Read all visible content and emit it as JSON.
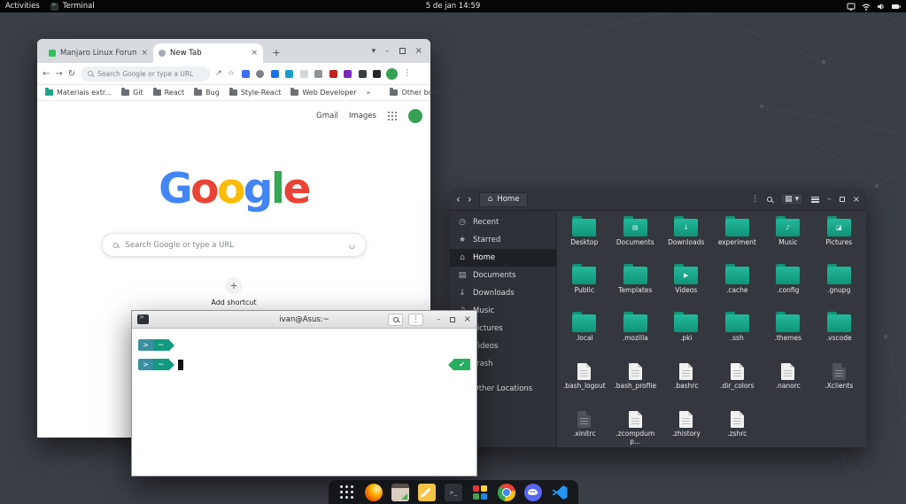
{
  "topbar": {
    "activities": "Activities",
    "focused_app": "Terminal",
    "clock": "5 de jan 14:59",
    "status_icons": [
      "display-icon",
      "wifi-icon",
      "volume-icon",
      "battery-icon"
    ]
  },
  "chrome_window": {
    "tabs": [
      {
        "title": "Manjaro Linux Forum"
      },
      {
        "title": "New Tab"
      }
    ],
    "omnibox": {
      "placeholder": "Search Google or type a URL"
    },
    "extensions": [
      {
        "name": "extension-icon-1",
        "color": "#3e6df0"
      },
      {
        "name": "extension-icon-2",
        "color": "#7b8187"
      },
      {
        "name": "extension-icon-3",
        "color": "#1a73e8"
      },
      {
        "name": "extension-icon-4",
        "color": "#15a0c8"
      },
      {
        "name": "extension-icon-5",
        "color": "#d3d6da"
      },
      {
        "name": "extension-icon-6",
        "color": "#8e9398"
      },
      {
        "name": "extension-icon-7",
        "color": "#c5221f"
      },
      {
        "name": "extension-icon-8",
        "color": "#7627bb"
      },
      {
        "name": "extension-icon-9",
        "color": "#3a3d41"
      },
      {
        "name": "extension-icon-10",
        "color": "#24262a"
      }
    ],
    "bookmarks_bar": {
      "items": [
        "Materiais extr...",
        "Git",
        "React",
        "Bug",
        "Style-React",
        "Web Developer"
      ],
      "overflow": "»",
      "other_bookmarks": "Other bookmarks"
    },
    "ntp": {
      "gmail_link": "Gmail",
      "images_link": "Images",
      "logo": [
        {
          "ch": "G",
          "color": "#4285F4"
        },
        {
          "ch": "o",
          "color": "#EA4335"
        },
        {
          "ch": "o",
          "color": "#FBBC05"
        },
        {
          "ch": "g",
          "color": "#4285F4"
        },
        {
          "ch": "l",
          "color": "#34A853"
        },
        {
          "ch": "e",
          "color": "#EA4335"
        }
      ],
      "search_placeholder": "Search Google or type a URL",
      "add_shortcut_label": "Add shortcut"
    }
  },
  "files_window": {
    "header": {
      "location": "Home"
    },
    "sidebar": [
      {
        "label": "Recent",
        "icon": "clock-icon"
      },
      {
        "label": "Starred",
        "icon": "star-icon"
      },
      {
        "label": "Home",
        "icon": "home-icon",
        "selected": true
      },
      {
        "label": "Documents",
        "icon": "document-icon"
      },
      {
        "label": "Downloads",
        "icon": "download-icon"
      },
      {
        "label": "Music",
        "icon": "music-icon"
      },
      {
        "label": "Pictures",
        "icon": "picture-icon"
      },
      {
        "label": "Videos",
        "icon": "video-icon"
      },
      {
        "label": "Trash",
        "icon": "trash-icon"
      },
      {
        "label": "Other Locations",
        "icon": "drive-icon"
      }
    ],
    "items": [
      {
        "label": "Desktop",
        "type": "folder"
      },
      {
        "label": "Documents",
        "type": "folder",
        "emblem": "▤"
      },
      {
        "label": "Downloads",
        "type": "folder",
        "emblem": "↓"
      },
      {
        "label": "experiment",
        "type": "folder"
      },
      {
        "label": "Music",
        "type": "folder",
        "emblem": "♪"
      },
      {
        "label": "Pictures",
        "type": "folder",
        "emblem": "◪"
      },
      {
        "label": "Public",
        "type": "folder"
      },
      {
        "label": "Templates",
        "type": "folder"
      },
      {
        "label": "Videos",
        "type": "folder",
        "emblem": "▶"
      },
      {
        "label": ".cache",
        "type": "folder"
      },
      {
        "label": ".config",
        "type": "folder"
      },
      {
        "label": ".gnupg",
        "type": "folder"
      },
      {
        "label": ".local",
        "type": "folder"
      },
      {
        "label": ".mozilla",
        "type": "folder"
      },
      {
        "label": ".pki",
        "type": "folder"
      },
      {
        "label": ".ssh",
        "type": "folder"
      },
      {
        "label": ".themes",
        "type": "folder"
      },
      {
        "label": ".vscode",
        "type": "folder"
      },
      {
        "label": ".bash_logout",
        "type": "file"
      },
      {
        "label": ".bash_profile",
        "type": "file"
      },
      {
        "label": ".bashrc",
        "type": "file"
      },
      {
        "label": ".dir_colors",
        "type": "file"
      },
      {
        "label": ".nanorc",
        "type": "file"
      },
      {
        "label": ".Xclients",
        "type": "file-dark"
      },
      {
        "label": ".xinitrc",
        "type": "file-dark"
      },
      {
        "label": ".zcompdump...",
        "type": "file"
      },
      {
        "label": ".zhistory",
        "type": "file"
      },
      {
        "label": ".zshrc",
        "type": "file"
      }
    ]
  },
  "terminal_window": {
    "title": "ivan@Asus:~",
    "prompt": {
      "dir": "~",
      "status": "✔"
    }
  },
  "dock": {
    "items": [
      "show-apps",
      "firefox",
      "files-app",
      "text-editor",
      "terminal",
      "color-palette",
      "chrome",
      "discord",
      "vscode"
    ]
  },
  "colors": {
    "folder_teal": "#16a085",
    "avatar_green": "#36a153",
    "prompt_green": "#119a80",
    "status_check_green": "#27ae60",
    "discord_blue": "#5865f2"
  }
}
